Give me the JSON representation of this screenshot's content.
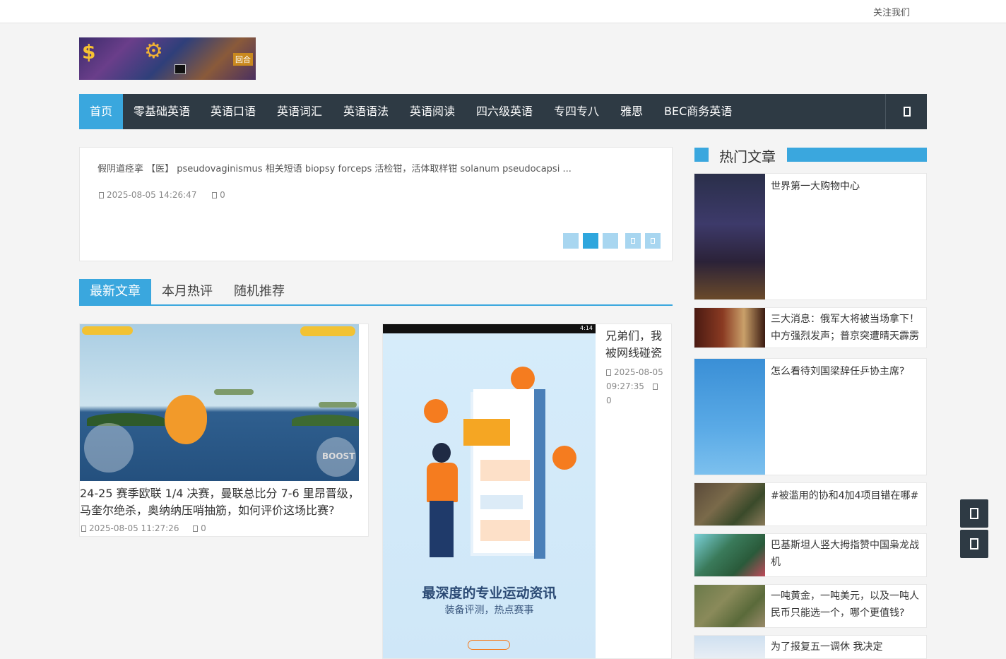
{
  "topbar": {
    "follow_label": "关注我们"
  },
  "nav": {
    "items": [
      "首页",
      "零基础英语",
      "英语口语",
      "英语词汇",
      "英语语法",
      "英语阅读",
      "四六级英语",
      "专四专八",
      "雅思",
      "BEC商务英语"
    ],
    "active": "首页",
    "search_icon": "search-icon"
  },
  "slider": {
    "text": "假阴道痉挛   【医】 pseudovaginismus 相关短语   biopsy forceps 活检钳，活体取样钳 solanum pseudocapsi ...",
    "date": "2025-08-05 14:26:47",
    "comments": "0"
  },
  "logo": {
    "tag": "回合"
  },
  "tabs": [
    "最新文章",
    "本月热评",
    "随机推荐"
  ],
  "posts": [
    {
      "title": "24-25 赛季欧联 1/4 决赛，曼联总比分 7-6 里昂晋级，马奎尔绝杀，奥纳纳压哨抽筋，如何评价这场比赛?",
      "date": "2025-08-05 11:27:26",
      "comments": "0",
      "image_text": {
        "boost": "BOOST"
      }
    },
    {
      "title": "兄弟们，我被网线碰瓷",
      "date": "2025-08-05 09:27:35",
      "comments": "0",
      "image_text": {
        "status": "4:14",
        "caption": "最深度的专业运动资讯",
        "subcaption": "装备评测，热点赛事"
      }
    }
  ],
  "sidebar": {
    "heading": "热门文章",
    "items": [
      "世界第一大购物中心",
      "三大消息：俄军大将被当场拿下！中方强烈发声；普京突遭晴天霹雳",
      "怎么看待刘国梁辞任乒协主席?",
      "#被滥用的协和4加4项目错在哪#",
      "巴基斯坦人竖大拇指赞中国枭龙战机",
      "一吨黄金，一吨美元，以及一吨人民币只能选一个，哪个更值钱?",
      "为了报复五一调休 我决定"
    ]
  },
  "colors": {
    "accent": "#3aa7de",
    "nav_bg": "#2e3a44",
    "page_bg": "#f4f4f4"
  }
}
